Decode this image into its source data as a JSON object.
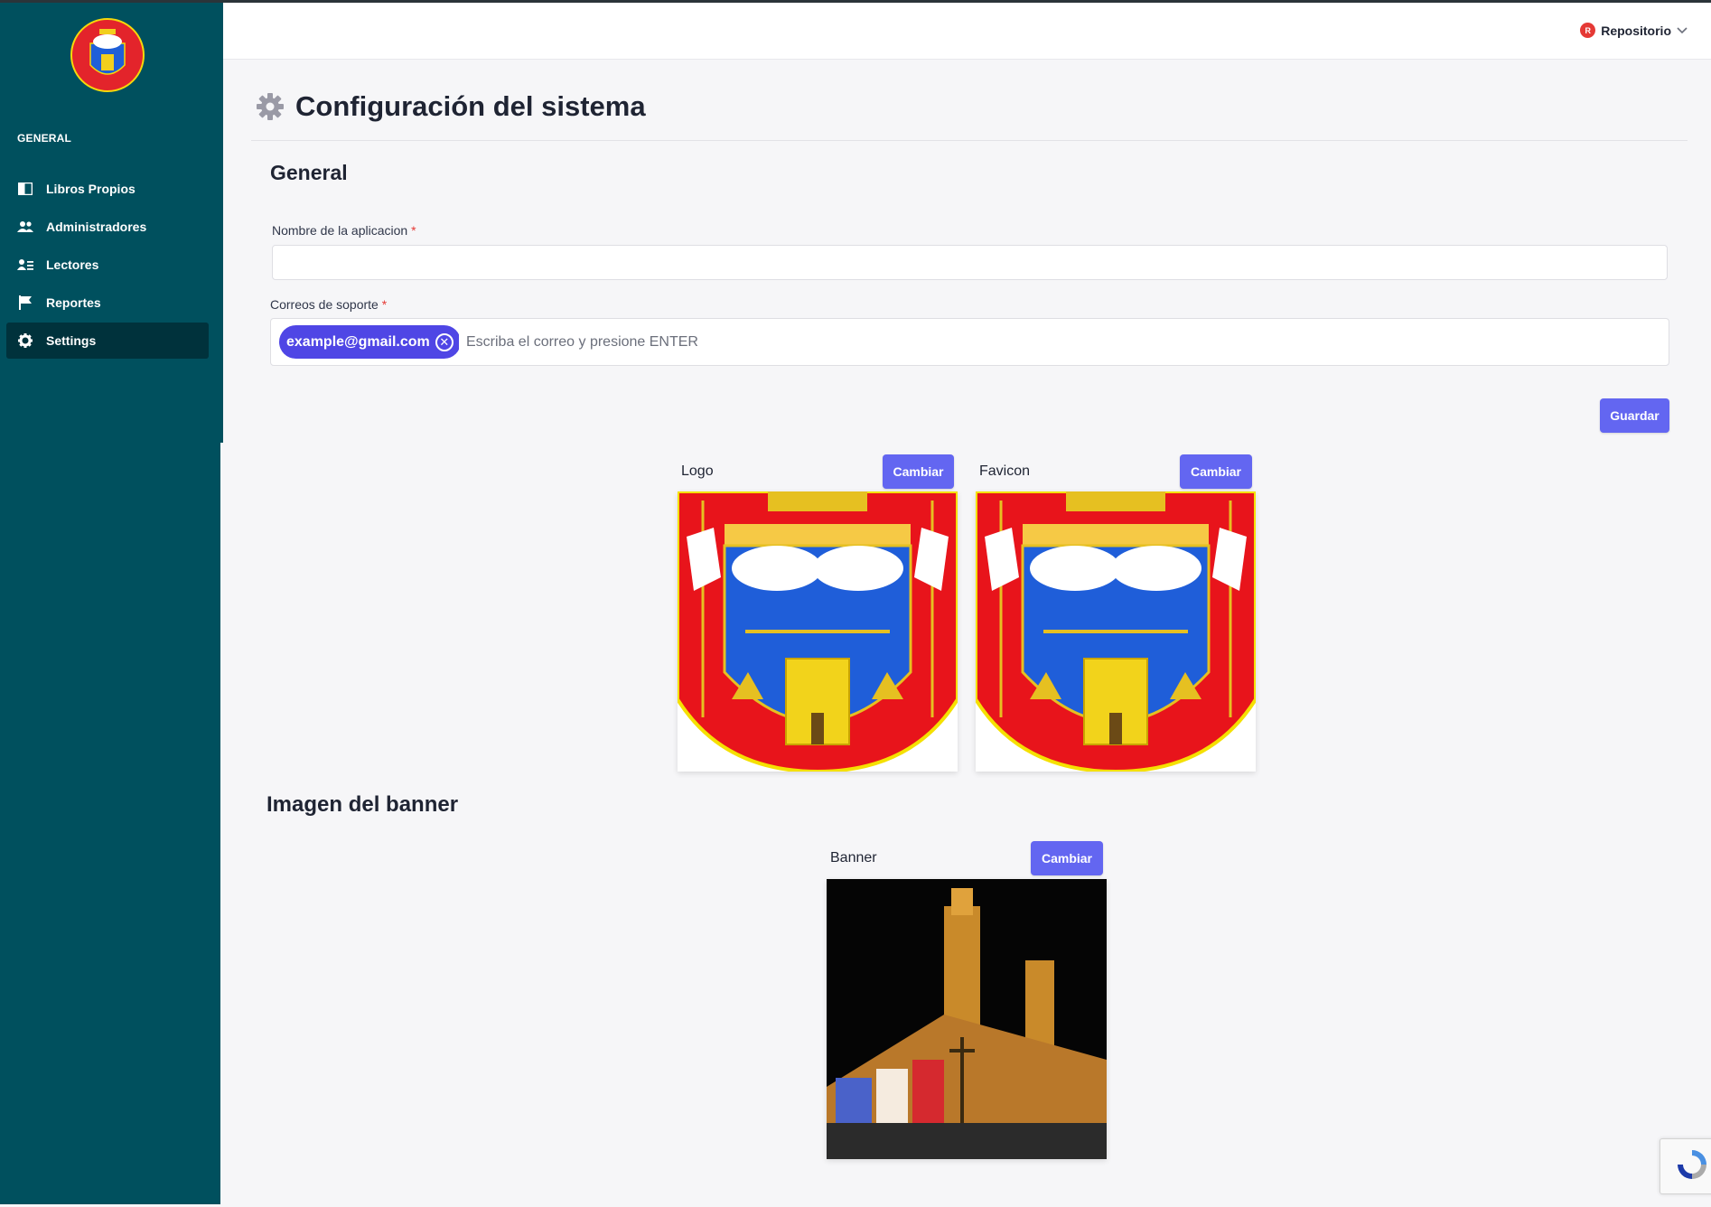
{
  "sidebar": {
    "section_label": "GENERAL",
    "items": [
      {
        "label": "Libros Propios",
        "icon": "book-icon"
      },
      {
        "label": "Administradores",
        "icon": "users-icon"
      },
      {
        "label": "Lectores",
        "icon": "readers-icon"
      },
      {
        "label": "Reportes",
        "icon": "flag-icon"
      },
      {
        "label": "Settings",
        "icon": "gear-icon",
        "active": true
      }
    ]
  },
  "header": {
    "user_initial": "R",
    "user_name": "Repositorio"
  },
  "page": {
    "title": "Configuración del sistema",
    "section_general": "General",
    "app_name_label": "Nombre de la aplicacion",
    "app_name_value": "",
    "required_mark": "*",
    "support_emails_label": "Correos de soporte",
    "support_email_tag": "example@gmail.com",
    "support_email_placeholder": "Escriba el correo y presione ENTER",
    "save_button": "Guardar",
    "logo_label": "Logo",
    "favicon_label": "Favicon",
    "change_button": "Cambiar",
    "banner_section_title": "Imagen del banner",
    "banner_label": "Banner"
  },
  "colors": {
    "sidebar_bg": "#00505e",
    "sidebar_active": "#00323c",
    "accent": "#6366f1",
    "tag_bg": "#4f46e5",
    "required": "#e53935"
  }
}
